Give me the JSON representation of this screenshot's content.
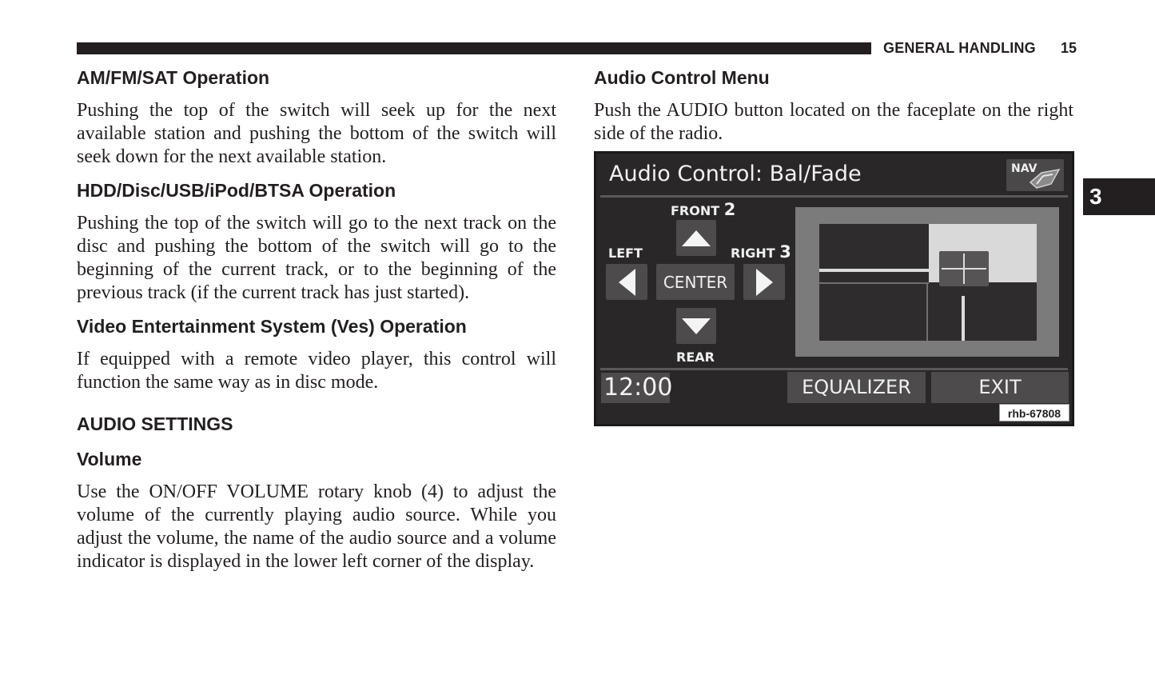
{
  "header": {
    "section_title": "GENERAL HANDLING",
    "page_number": "15",
    "chapter_tab": "3"
  },
  "left_column": {
    "am_fm_heading": "AM/FM/SAT Operation",
    "am_fm_body": "Pushing the top of the switch will seek up for the next available station and pushing the bottom of the switch will seek down for the next available station.",
    "hdd_heading": "HDD/Disc/USB/iPod/BTSA Operation",
    "hdd_body": "Pushing the top of the switch will go to the next track on the disc and pushing the bottom of the switch will go to the beginning of the current track, or to the beginning of the previous track (if the current track has just started).",
    "ves_heading": "Video Entertainment System (Ves) Operation",
    "ves_body": "If equipped with a remote video player, this control will function the same way as in disc mode.",
    "audio_settings_heading": "AUDIO SETTINGS",
    "volume_heading": "Volume",
    "volume_body": "Use the ON/OFF VOLUME rotary knob (4) to adjust the volume of the currently playing audio source. While you adjust the volume, the name of the audio source and a volume indicator is displayed in the lower left corner of the display."
  },
  "right_column": {
    "audio_menu_heading": "Audio Control Menu",
    "audio_menu_body": "Push the AUDIO button located on the faceplate on the right side of the radio."
  },
  "screen": {
    "title": "Audio Control: Bal/Fade",
    "nav_label": "NAV",
    "front_label": "FRONT",
    "front_callout": "2",
    "left_label": "LEFT",
    "right_label": "RIGHT",
    "right_callout": "3",
    "rear_label": "REAR",
    "center_button": "CENTER",
    "clock": "12:00",
    "equalizer_button": "EQUALIZER",
    "exit_button": "EXIT",
    "image_ref": "rhb-67808",
    "balance_position": "right",
    "fade_position": "front"
  }
}
